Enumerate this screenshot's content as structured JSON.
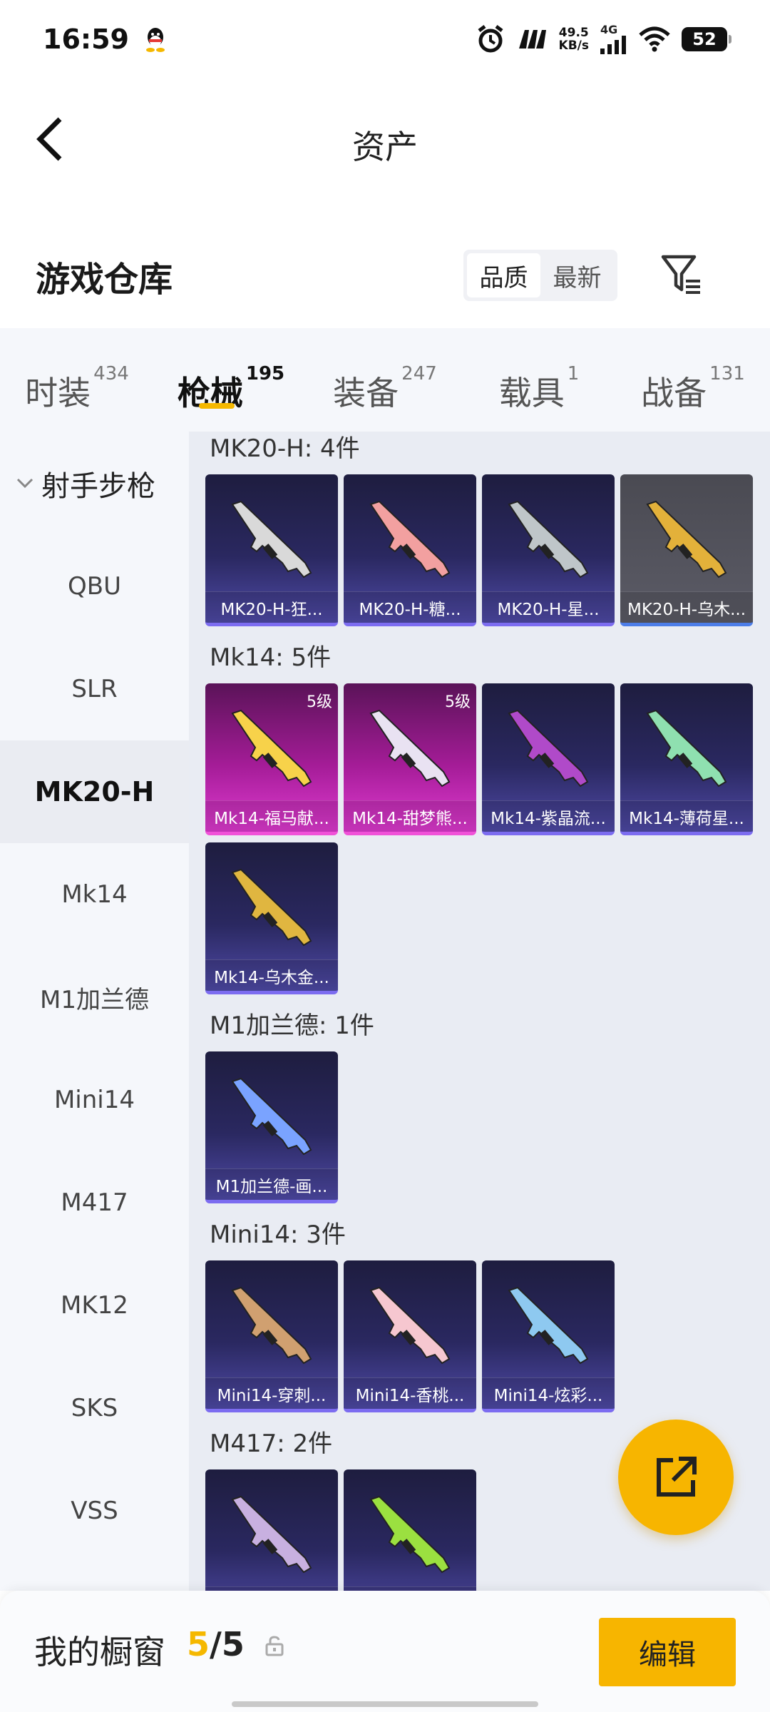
{
  "status_bar": {
    "time": "16:59",
    "net_speed_value": "49.5",
    "net_speed_unit": "KB/s",
    "network": "4G",
    "battery": "52"
  },
  "header": {
    "title": "资产"
  },
  "warehouse": {
    "title": "游戏仓库",
    "sort_options": [
      "品质",
      "最新"
    ],
    "active_sort": "品质"
  },
  "tabs": [
    {
      "label": "时装",
      "count": "434"
    },
    {
      "label": "枪械",
      "count": "195",
      "active": true
    },
    {
      "label": "装备",
      "count": "247"
    },
    {
      "label": "载具",
      "count": "1"
    },
    {
      "label": "战备",
      "count": "131"
    }
  ],
  "sidebar": {
    "group": "射手步枪",
    "items": [
      "QBU",
      "SLR",
      "MK20-H",
      "Mk14",
      "M1加兰德",
      "Mini14",
      "M417",
      "MK12",
      "SKS",
      "VSS"
    ],
    "active": "MK20-H"
  },
  "sections": [
    {
      "title": "MK20-H: 4件",
      "items": [
        {
          "name": "MK20-H-狂...",
          "style": "purple"
        },
        {
          "name": "MK20-H-糖...",
          "style": "purple"
        },
        {
          "name": "MK20-H-星...",
          "style": "purple"
        },
        {
          "name": "MK20-H-乌木...",
          "style": "gray"
        }
      ]
    },
    {
      "title": "Mk14: 5件",
      "items": [
        {
          "name": "Mk14-福马献...",
          "style": "pink",
          "level": "5级"
        },
        {
          "name": "Mk14-甜梦熊...",
          "style": "pink",
          "level": "5级"
        },
        {
          "name": "Mk14-紫晶流...",
          "style": "purple"
        },
        {
          "name": "Mk14-薄荷星...",
          "style": "purple"
        },
        {
          "name": "Mk14-乌木金...",
          "style": "purple"
        }
      ]
    },
    {
      "title": "M1加兰德: 1件",
      "items": [
        {
          "name": "M1加兰德-画...",
          "style": "purple"
        }
      ]
    },
    {
      "title": "Mini14: 3件",
      "items": [
        {
          "name": "Mini14-穿刺...",
          "style": "purple"
        },
        {
          "name": "Mini14-香桃...",
          "style": "purple"
        },
        {
          "name": "Mini14-炫彩...",
          "style": "purple"
        }
      ]
    },
    {
      "title": "M417: 2件",
      "items": [
        {
          "name": "",
          "style": "purple"
        },
        {
          "name": "",
          "style": "purple"
        }
      ]
    }
  ],
  "bottom": {
    "window_label": "我的橱窗",
    "window_current": "5",
    "window_total": "/5",
    "edit_label": "编辑"
  },
  "colors": {
    "accent": "#f7b500",
    "purple_card": "#2a2860",
    "pink_card": "#a41c97",
    "gray_card": "#5b5b66"
  },
  "icons": {
    "back": "chevron-left-icon",
    "filter": "filter-icon",
    "share": "share-icon",
    "lock": "lock-icon"
  }
}
